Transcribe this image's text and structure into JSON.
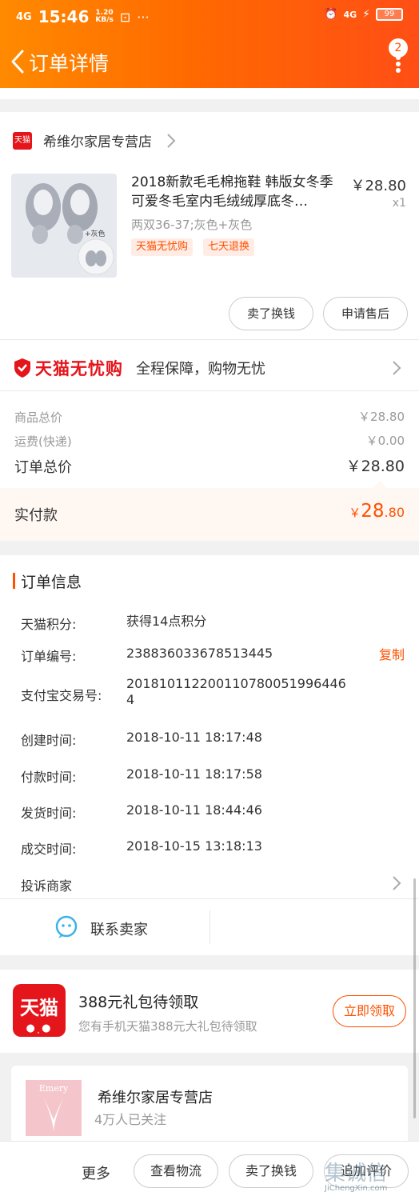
{
  "status_bar": {
    "network": "4G",
    "time": "15:46",
    "speed_value": "1.20",
    "speed_unit": "KB/s",
    "net_right": "4G",
    "battery": "99"
  },
  "nav": {
    "title": "订单详情",
    "badge_count": "2"
  },
  "store": {
    "tmall_tag": "天猫",
    "name": "希维尔家居专营店"
  },
  "product": {
    "title": "2018新款毛毛棉拖鞋 韩版女冬季可爱冬毛室内毛绒绒厚底冬…",
    "price": "￥28.80",
    "qty": "x1",
    "spec": "两双36-37;灰色+灰色",
    "image_caption": "+灰色",
    "tags": [
      "天猫无忧购",
      "七天退换"
    ],
    "btn_sell": "卖了换钱",
    "btn_aftersale": "申请售后"
  },
  "guarantee": {
    "logo_text": "天猫无忧购",
    "slogan": "全程保障，购物无忧"
  },
  "totals": {
    "goods_label": "商品总价",
    "goods_value": "￥28.80",
    "shipping_label": "运费(快递)",
    "shipping_value": "￥0.00",
    "order_label": "订单总价",
    "order_value": "￥28.80",
    "paid_label": "实付款",
    "paid_currency": "￥",
    "paid_int": "28",
    "paid_dec": ".80"
  },
  "order_info": {
    "heading": "订单信息",
    "rows": [
      {
        "label": "天猫积分:",
        "value": "获得14点积分"
      },
      {
        "label": "订单编号:",
        "value": "238836033678513445"
      },
      {
        "label": "支付宝交易号:",
        "value": "2018101122001107800519964464"
      },
      {
        "label": "创建时间:",
        "value": "2018-10-11 18:17:48"
      },
      {
        "label": "付款时间:",
        "value": "2018-10-11 18:17:58"
      },
      {
        "label": "发货时间:",
        "value": "2018-10-11 18:44:46"
      },
      {
        "label": "成交时间:",
        "value": "2018-10-15 13:18:13"
      }
    ],
    "copy_label": "复制",
    "complaint_label": "投诉商家"
  },
  "contact": {
    "label": "联系卖家"
  },
  "promo": {
    "logo_text": "天猫",
    "title": "388元礼包待领取",
    "subtitle": "您有手机天猫388元大礼包待领取",
    "claim_label": "立即领取"
  },
  "shop_card": {
    "logo_text": "Emery",
    "name": "希维尔家居专营店",
    "followers": "4万人已关注"
  },
  "bottom_bar": {
    "more": "更多",
    "logistics": "查看物流",
    "sell": "卖了换钱",
    "review": "追加评价"
  },
  "watermark": {
    "brand": "集诚信",
    "url": "JiChengXin.com"
  },
  "colors": {
    "accent": "#ff5000",
    "tmall_red": "#e4151b",
    "header_start": "#ff8a00",
    "header_end": "#ff4e16"
  }
}
